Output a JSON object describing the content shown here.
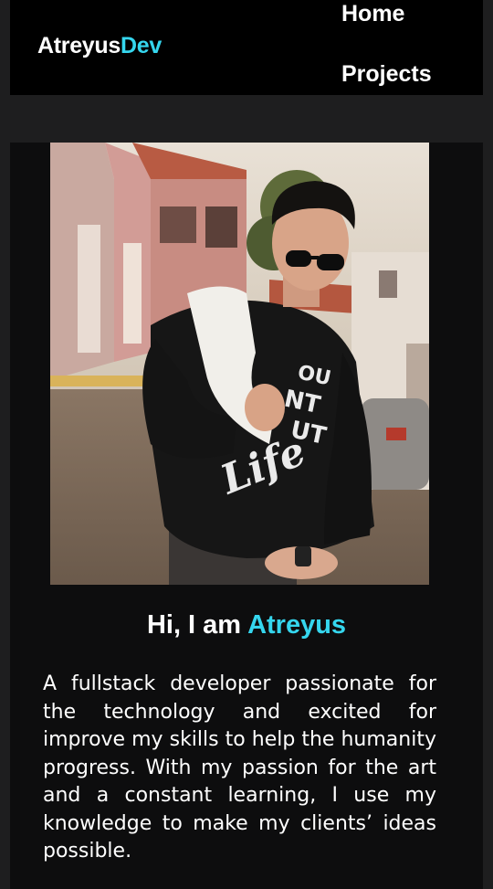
{
  "header": {
    "logo_main": "Atreyus",
    "logo_accent": "Dev",
    "nav": [
      {
        "label": "Home"
      },
      {
        "label": "Projects"
      }
    ]
  },
  "hero": {
    "greeting_prefix": "Hi, I am ",
    "greeting_name": "Atreyus",
    "bio": "A fullstack developer passionate for the technology and excited for improve my skills to help the humanity progress. With my passion for the art and a constant learning, I use my knowledge to make my clients’ ideas possible.",
    "photo_icon": "profile-photo",
    "shirt_text": "YOU AIN'T BUT A LIFE"
  },
  "colors": {
    "accent": "#35d6ee",
    "background": "#1e1e1f",
    "header_bg": "#000000",
    "card_bg": "#0d0d0e",
    "text": "#ffffff"
  }
}
